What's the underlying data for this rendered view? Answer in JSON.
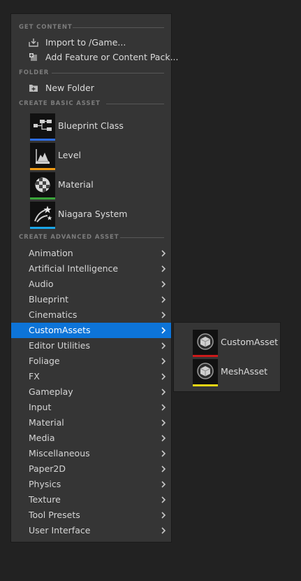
{
  "menu": {
    "sections": {
      "get_content": "GET CONTENT",
      "folder": "FOLDER",
      "create_basic": "CREATE BASIC ASSET",
      "create_advanced": "CREATE ADVANCED ASSET"
    },
    "get_content_items": [
      {
        "label": "Import to /Game...",
        "icon": "import-icon"
      },
      {
        "label": "Add Feature or Content Pack...",
        "icon": "add-content-pack-icon"
      }
    ],
    "folder_items": [
      {
        "label": "New Folder",
        "icon": "new-folder-icon"
      }
    ],
    "basic_assets": [
      {
        "label": "Blueprint Class",
        "icon": "blueprint-class-icon",
        "color": "#2e6ee8"
      },
      {
        "label": "Level",
        "icon": "level-icon",
        "color": "#f09a13"
      },
      {
        "label": "Material",
        "icon": "material-icon",
        "color": "#3aa53a"
      },
      {
        "label": "Niagara System",
        "icon": "niagara-system-icon",
        "color": "#1aa6e8"
      }
    ],
    "advanced_categories": [
      {
        "label": "Animation"
      },
      {
        "label": "Artificial Intelligence"
      },
      {
        "label": "Audio"
      },
      {
        "label": "Blueprint"
      },
      {
        "label": "Cinematics"
      },
      {
        "label": "CustomAssets",
        "selected": true
      },
      {
        "label": "Editor Utilities"
      },
      {
        "label": "Foliage"
      },
      {
        "label": "FX"
      },
      {
        "label": "Gameplay"
      },
      {
        "label": "Input"
      },
      {
        "label": "Material"
      },
      {
        "label": "Media"
      },
      {
        "label": "Miscellaneous"
      },
      {
        "label": "Paper2D"
      },
      {
        "label": "Physics"
      },
      {
        "label": "Texture"
      },
      {
        "label": "Tool Presets"
      },
      {
        "label": "User Interface"
      }
    ]
  },
  "submenu": {
    "items": [
      {
        "label": "CustomAsset",
        "icon": "cube-icon",
        "color": "#cc1a1a"
      },
      {
        "label": "MeshAsset",
        "icon": "cube-icon",
        "color": "#e8d514"
      }
    ]
  },
  "colors": {
    "selection": "#0d74d8",
    "menu_bg": "#353535",
    "page_bg": "#222222"
  }
}
